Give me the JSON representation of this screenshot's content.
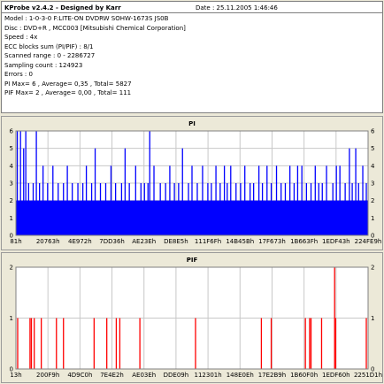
{
  "info": {
    "title": "KProbe v2.4.2 - Designed by Karr",
    "date": "Date : 25.11.2005 1:46:46",
    "lines": [
      "Model : 1-0-3-0 F:LITE-ON DVDRW SOHW-1673S JS0B",
      "Disc : DVD+R , MCC003 [Mitsubishi Chemical Corporation]",
      "Speed : 4x",
      "ECC blocks sum (PI/PIF) : 8/1",
      "Scanned range : 0 - 2286727",
      "Sampling count : 124923",
      "Errors : 0",
      "PI Max= 6 , Average= 0,35 , Total= 5827",
      "PIF Max= 2 , Average= 0,00 , Total= 111"
    ]
  },
  "chart_data": [
    {
      "type": "bar",
      "title": "PI",
      "ylim": [
        0,
        6
      ],
      "yticks": [
        "0",
        "1",
        "2",
        "3",
        "4",
        "5",
        "6"
      ],
      "xtick_labels": [
        "81h",
        "20763h",
        "4E972h",
        "7DD36h",
        "AE23Eh",
        "DE8E5h",
        "111F6Fh",
        "14B45Bh",
        "17F673h",
        "1B663Fh",
        "1EDF43h",
        "224FE9h"
      ],
      "color": "#0000ff",
      "baseline": 2,
      "grid": true,
      "spikes": [
        {
          "x": 0.004,
          "y": 6
        },
        {
          "x": 0.013,
          "y": 6
        },
        {
          "x": 0.022,
          "y": 5
        },
        {
          "x": 0.028,
          "y": 6
        },
        {
          "x": 0.036,
          "y": 3
        },
        {
          "x": 0.049,
          "y": 3
        },
        {
          "x": 0.058,
          "y": 6
        },
        {
          "x": 0.067,
          "y": 3
        },
        {
          "x": 0.077,
          "y": 4
        },
        {
          "x": 0.09,
          "y": 3
        },
        {
          "x": 0.105,
          "y": 4
        },
        {
          "x": 0.12,
          "y": 3
        },
        {
          "x": 0.135,
          "y": 3
        },
        {
          "x": 0.146,
          "y": 4
        },
        {
          "x": 0.16,
          "y": 3
        },
        {
          "x": 0.176,
          "y": 3
        },
        {
          "x": 0.19,
          "y": 3
        },
        {
          "x": 0.2,
          "y": 4
        },
        {
          "x": 0.215,
          "y": 3
        },
        {
          "x": 0.225,
          "y": 5
        },
        {
          "x": 0.24,
          "y": 3
        },
        {
          "x": 0.255,
          "y": 3
        },
        {
          "x": 0.27,
          "y": 4
        },
        {
          "x": 0.283,
          "y": 3
        },
        {
          "x": 0.3,
          "y": 3
        },
        {
          "x": 0.31,
          "y": 5
        },
        {
          "x": 0.322,
          "y": 3
        },
        {
          "x": 0.34,
          "y": 4
        },
        {
          "x": 0.355,
          "y": 3
        },
        {
          "x": 0.365,
          "y": 3
        },
        {
          "x": 0.375,
          "y": 3
        },
        {
          "x": 0.38,
          "y": 6
        },
        {
          "x": 0.392,
          "y": 4
        },
        {
          "x": 0.41,
          "y": 3
        },
        {
          "x": 0.425,
          "y": 3
        },
        {
          "x": 0.437,
          "y": 4
        },
        {
          "x": 0.45,
          "y": 3
        },
        {
          "x": 0.462,
          "y": 3
        },
        {
          "x": 0.473,
          "y": 5
        },
        {
          "x": 0.49,
          "y": 3
        },
        {
          "x": 0.5,
          "y": 4
        },
        {
          "x": 0.515,
          "y": 3
        },
        {
          "x": 0.53,
          "y": 4
        },
        {
          "x": 0.545,
          "y": 3
        },
        {
          "x": 0.555,
          "y": 3
        },
        {
          "x": 0.568,
          "y": 4
        },
        {
          "x": 0.58,
          "y": 3
        },
        {
          "x": 0.592,
          "y": 4
        },
        {
          "x": 0.6,
          "y": 3
        },
        {
          "x": 0.61,
          "y": 4
        },
        {
          "x": 0.625,
          "y": 3
        },
        {
          "x": 0.638,
          "y": 3
        },
        {
          "x": 0.65,
          "y": 4
        },
        {
          "x": 0.665,
          "y": 3
        },
        {
          "x": 0.675,
          "y": 3
        },
        {
          "x": 0.69,
          "y": 4
        },
        {
          "x": 0.7,
          "y": 3
        },
        {
          "x": 0.713,
          "y": 4
        },
        {
          "x": 0.725,
          "y": 3
        },
        {
          "x": 0.74,
          "y": 4
        },
        {
          "x": 0.753,
          "y": 3
        },
        {
          "x": 0.765,
          "y": 3
        },
        {
          "x": 0.778,
          "y": 4
        },
        {
          "x": 0.79,
          "y": 3
        },
        {
          "x": 0.8,
          "y": 4
        },
        {
          "x": 0.812,
          "y": 4
        },
        {
          "x": 0.825,
          "y": 3
        },
        {
          "x": 0.838,
          "y": 3
        },
        {
          "x": 0.85,
          "y": 4
        },
        {
          "x": 0.86,
          "y": 3
        },
        {
          "x": 0.87,
          "y": 3
        },
        {
          "x": 0.882,
          "y": 4
        },
        {
          "x": 0.9,
          "y": 3
        },
        {
          "x": 0.91,
          "y": 4
        },
        {
          "x": 0.92,
          "y": 4
        },
        {
          "x": 0.935,
          "y": 3
        },
        {
          "x": 0.947,
          "y": 5
        },
        {
          "x": 0.955,
          "y": 3
        },
        {
          "x": 0.965,
          "y": 5
        },
        {
          "x": 0.973,
          "y": 3
        },
        {
          "x": 0.985,
          "y": 4
        },
        {
          "x": 0.995,
          "y": 3
        }
      ]
    },
    {
      "type": "bar",
      "title": "PIF",
      "ylim": [
        0,
        2
      ],
      "yticks": [
        "0",
        "1",
        "2"
      ],
      "xtick_labels": [
        "13h",
        "200F9h",
        "4D9C0h",
        "7E4E2h",
        "AE03Eh",
        "DDE09h",
        "112301h",
        "148E0Eh",
        "17E2B9h",
        "1B60F0h",
        "1EDF60h",
        "2251D1h"
      ],
      "color": "#ff0000",
      "grid": true,
      "spikes": [
        {
          "x": 0.005,
          "y": 1
        },
        {
          "x": 0.04,
          "y": 1
        },
        {
          "x": 0.044,
          "y": 1
        },
        {
          "x": 0.052,
          "y": 1
        },
        {
          "x": 0.072,
          "y": 1
        },
        {
          "x": 0.115,
          "y": 1
        },
        {
          "x": 0.135,
          "y": 1
        },
        {
          "x": 0.222,
          "y": 1
        },
        {
          "x": 0.258,
          "y": 1
        },
        {
          "x": 0.285,
          "y": 1
        },
        {
          "x": 0.295,
          "y": 1
        },
        {
          "x": 0.352,
          "y": 1
        },
        {
          "x": 0.51,
          "y": 1
        },
        {
          "x": 0.697,
          "y": 1
        },
        {
          "x": 0.725,
          "y": 1
        },
        {
          "x": 0.822,
          "y": 1
        },
        {
          "x": 0.834,
          "y": 1
        },
        {
          "x": 0.838,
          "y": 1
        },
        {
          "x": 0.868,
          "y": 1
        },
        {
          "x": 0.905,
          "y": 2
        },
        {
          "x": 0.908,
          "y": 1
        },
        {
          "x": 0.995,
          "y": 1
        }
      ]
    }
  ]
}
